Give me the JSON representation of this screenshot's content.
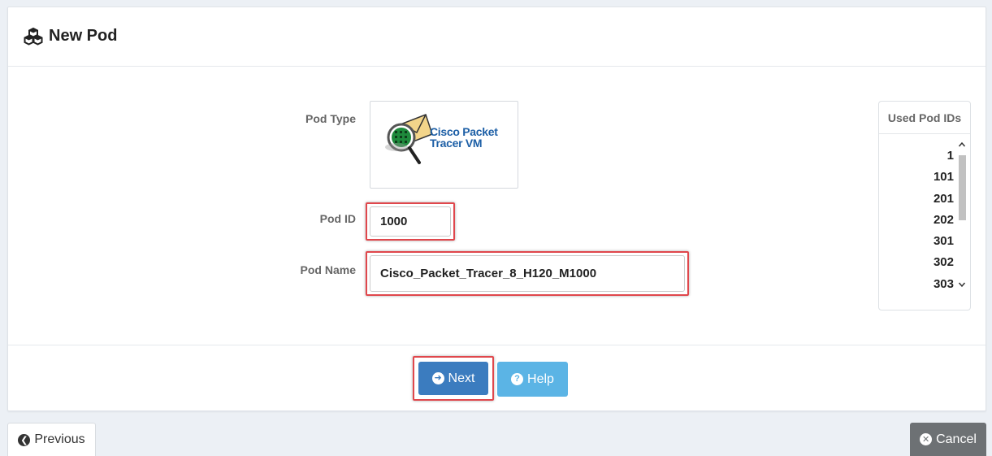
{
  "header": {
    "title": "New Pod",
    "icon": "cubes-icon"
  },
  "form": {
    "pod_type_label": "Pod Type",
    "pod_type_image_text_line1": "Cisco Packet",
    "pod_type_image_text_line2": "Tracer VM",
    "pod_id_label": "Pod ID",
    "pod_id_value": "1000",
    "pod_name_label": "Pod Name",
    "pod_name_value": "Cisco_Packet_Tracer_8_H120_M1000"
  },
  "used_pod_ids": {
    "title": "Used Pod IDs",
    "items": [
      "1",
      "101",
      "201",
      "202",
      "301",
      "302",
      "303"
    ]
  },
  "footer": {
    "next_label": "Next",
    "help_label": "Help"
  },
  "nav": {
    "previous_label": "Previous",
    "cancel_label": "Cancel"
  },
  "colors": {
    "primary": "#3b7cbf",
    "info": "#5bb4e5",
    "highlight": "#e0474c",
    "cancel": "#6d7174"
  }
}
